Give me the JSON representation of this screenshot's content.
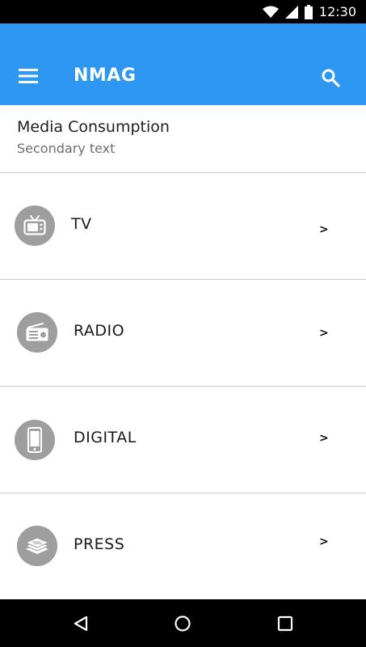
{
  "status_bar": {
    "time": "12:30",
    "icons": [
      "wifi-icon",
      "signal-icon",
      "battery-icon"
    ]
  },
  "app_bar": {
    "title": "NMAG",
    "menu_icon": "menu-icon",
    "search_icon": "search-icon",
    "color": "#2e97f1"
  },
  "header": {
    "title": "Media Consumption",
    "subtitle": "Secondary text"
  },
  "list": {
    "items": [
      {
        "label": "TV",
        "icon": "tv-icon",
        "chevron": ">"
      },
      {
        "label": "RADIO",
        "icon": "radio-icon",
        "chevron": ">"
      },
      {
        "label": "DIGITAL",
        "icon": "smartphone-icon",
        "chevron": ">"
      },
      {
        "label": "PRESS",
        "icon": "newspaper-icon",
        "chevron": ">"
      }
    ]
  },
  "nav_bar": {
    "icons": [
      "back-icon",
      "home-icon",
      "recents-icon"
    ]
  }
}
